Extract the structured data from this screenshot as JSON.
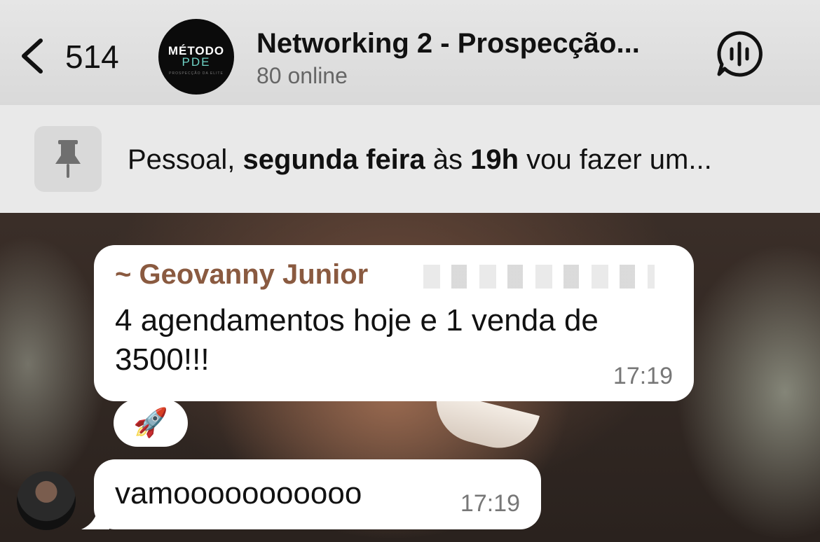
{
  "header": {
    "back_count": "514",
    "group_avatar": {
      "line1": "MÉTODO",
      "line2": "PDE",
      "line3": "PROSPECÇÃO DA ELITE"
    },
    "title": "Networking 2 - Prospecção...",
    "status": "80 online"
  },
  "pinned": {
    "text_parts": [
      "Pessoal, ",
      "segunda feira",
      " às ",
      "19h",
      " vou fazer um..."
    ]
  },
  "messages": [
    {
      "sender": "~ Geovanny Junior",
      "text": "4 agendamentos hoje e 1 venda de 3500!!!",
      "time": "17:19",
      "reaction": "🚀"
    },
    {
      "text": "vamooooooooooo",
      "time": "17:19"
    }
  ],
  "icons": {
    "back": "chevron-left-icon",
    "voice": "voice-chat-icon",
    "pin": "pin-icon"
  },
  "colors": {
    "sender_name": "#8a5a40",
    "logo_accent": "#6fd3c6"
  }
}
